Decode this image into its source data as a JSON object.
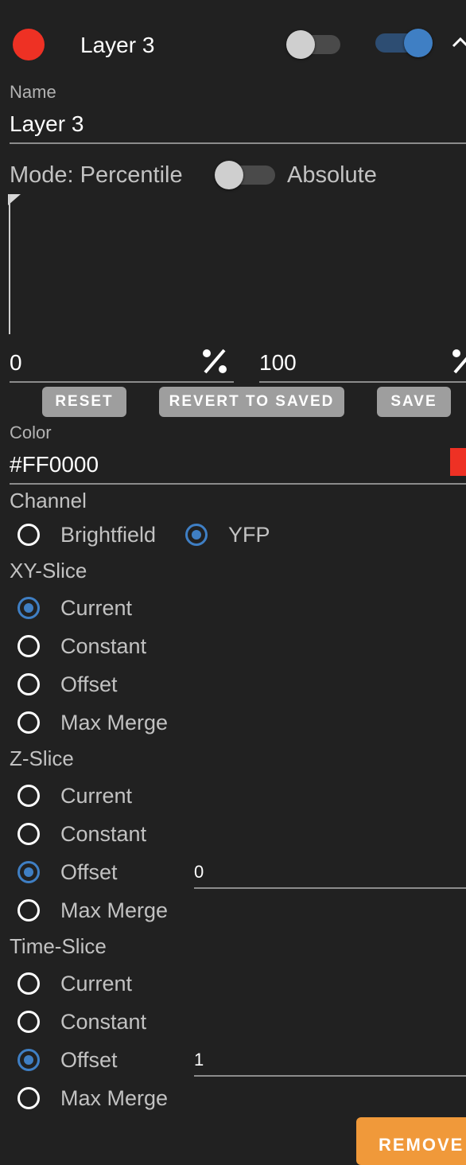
{
  "layer": {
    "title": "Layer 3",
    "color_dot": "#EE3124",
    "toggle_left_on": false,
    "toggle_right_on": true
  },
  "name": {
    "label": "Name",
    "value": "Layer 3"
  },
  "mode": {
    "left_label": "Mode: Percentile",
    "right_label": "Absolute",
    "absolute_on": false
  },
  "range": {
    "min_value": "0",
    "max_value": "100",
    "min_icon": "percent-icon",
    "max_icon": "percent-icon"
  },
  "buttons": {
    "reset": "RESET",
    "revert": "REVERT TO SAVED",
    "save": "SAVE"
  },
  "color": {
    "label": "Color",
    "value": "#FF0000",
    "swatch": "#EE3124"
  },
  "channel": {
    "title": "Channel",
    "options": [
      {
        "label": "Brightfield",
        "selected": false
      },
      {
        "label": "YFP",
        "selected": true
      }
    ]
  },
  "xy_slice": {
    "title": "XY-Slice",
    "options": [
      {
        "label": "Current",
        "selected": true
      },
      {
        "label": "Constant",
        "selected": false
      },
      {
        "label": "Offset",
        "selected": false
      },
      {
        "label": "Max Merge",
        "selected": false
      }
    ]
  },
  "z_slice": {
    "title": "Z-Slice",
    "options": [
      {
        "label": "Current",
        "selected": false
      },
      {
        "label": "Constant",
        "selected": false
      },
      {
        "label": "Offset",
        "selected": true
      },
      {
        "label": "Max Merge",
        "selected": false
      }
    ],
    "offset_value": "0"
  },
  "time_slice": {
    "title": "Time-Slice",
    "options": [
      {
        "label": "Current",
        "selected": false
      },
      {
        "label": "Constant",
        "selected": false
      },
      {
        "label": "Offset",
        "selected": true
      },
      {
        "label": "Max Merge",
        "selected": false
      }
    ],
    "offset_value": "1"
  },
  "remove": {
    "label": "REMOVE"
  }
}
